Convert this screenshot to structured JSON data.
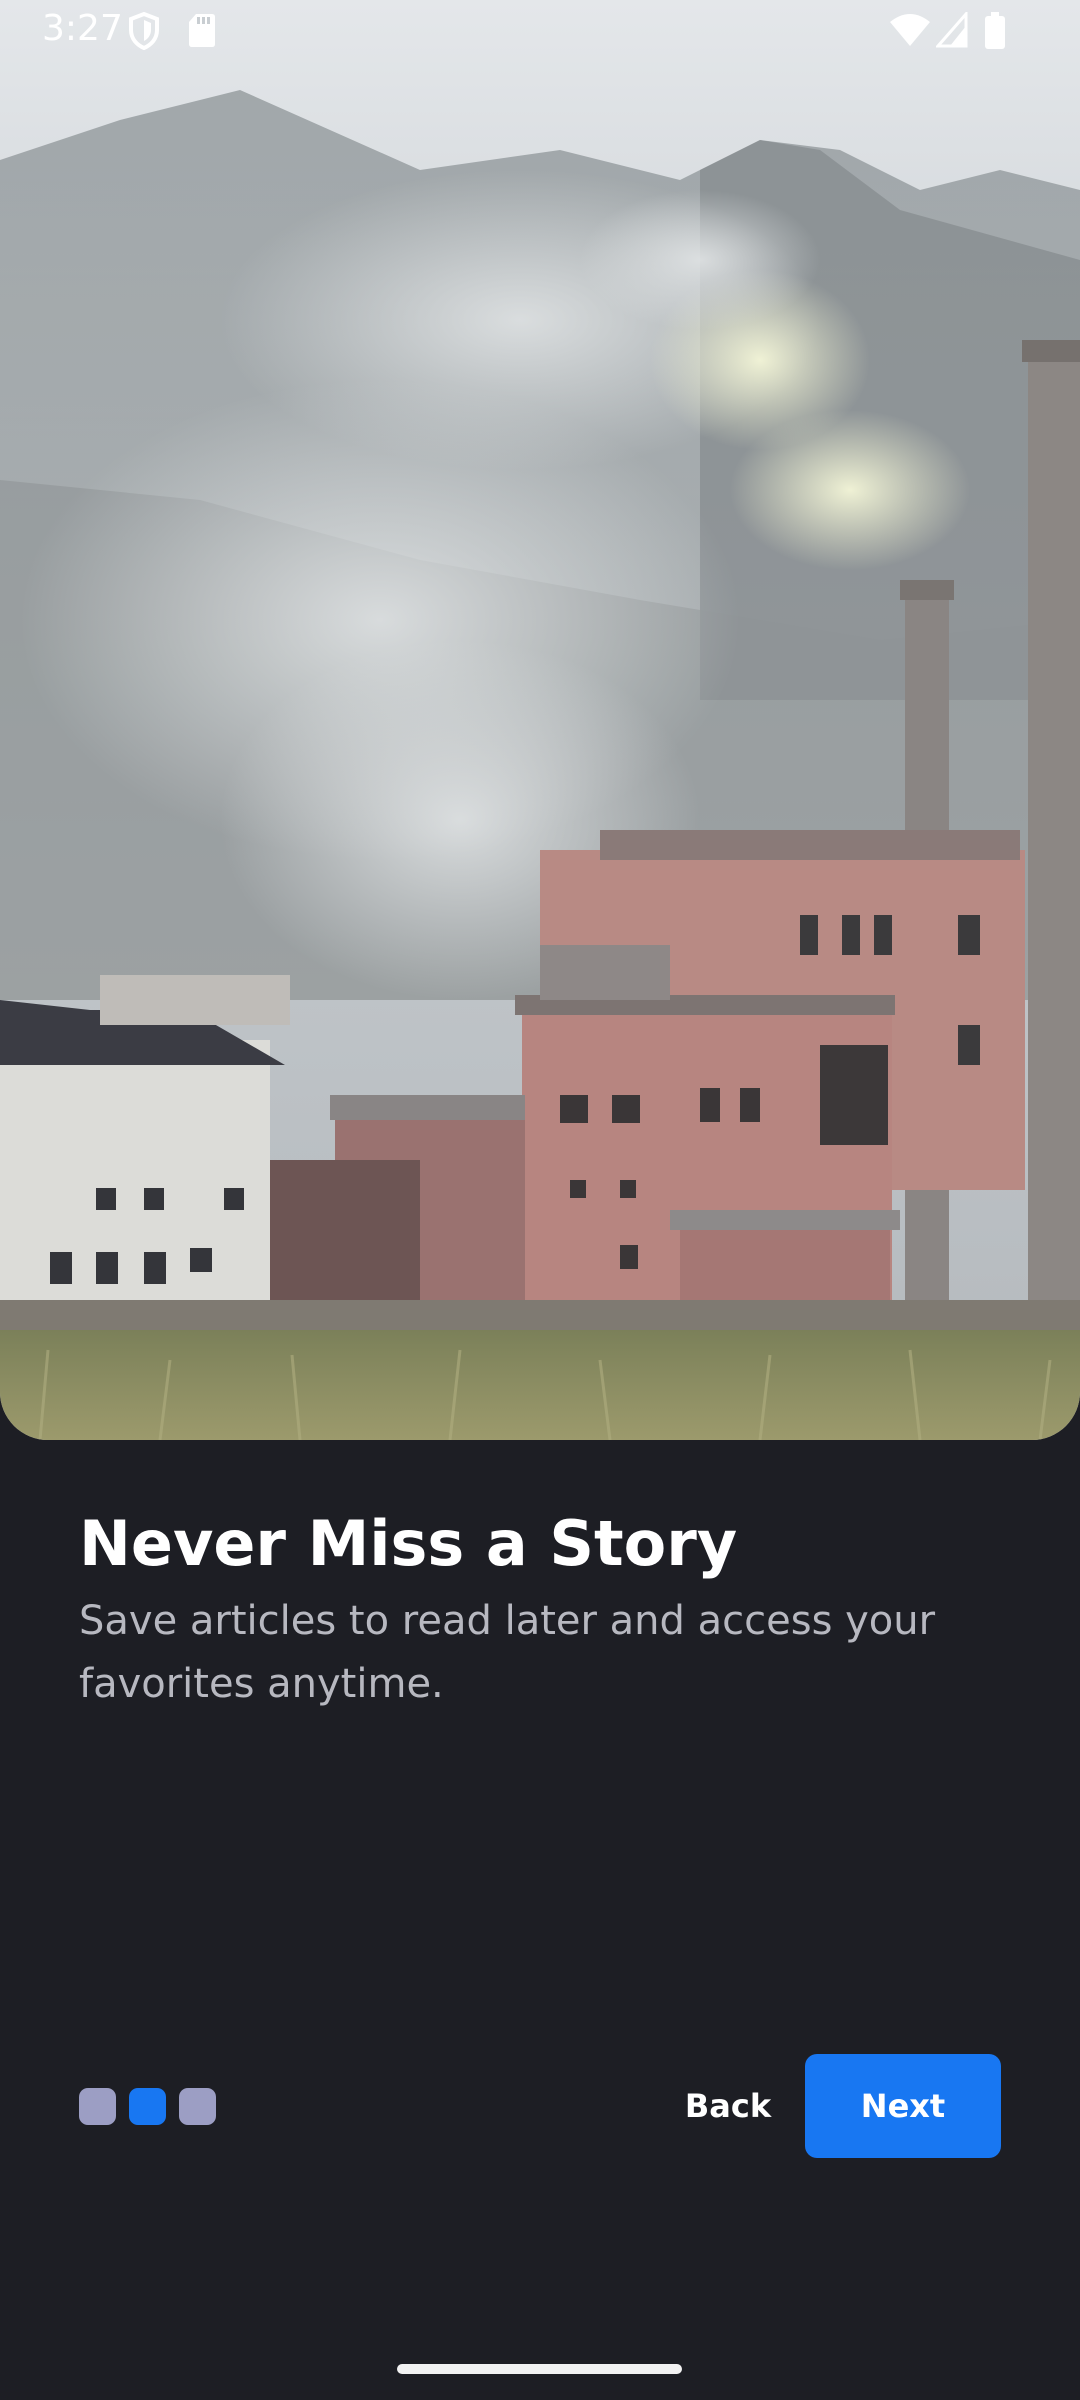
{
  "status_bar": {
    "time": "3:27",
    "left_icons": [
      "shield-icon",
      "sd-card-icon"
    ],
    "right_icons": [
      "wifi-icon",
      "signal-icon",
      "battery-icon"
    ]
  },
  "onboarding": {
    "title": "Never Miss a Story",
    "subtitle": "Save articles to read later and access your favorites anytime.",
    "page_indicator": {
      "total": 3,
      "current": 2
    }
  },
  "buttons": {
    "back_label": "Back",
    "next_label": "Next"
  },
  "colors": {
    "background": "#1d1e24",
    "accent": "#1877f2",
    "dot_inactive": "#9c9ec4",
    "subtitle": "#b7b8c0"
  }
}
